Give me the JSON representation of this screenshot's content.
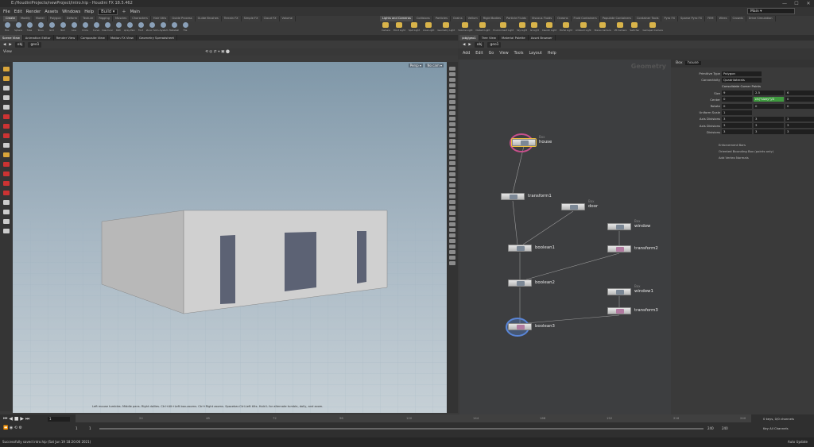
{
  "window": {
    "title": "E:/HoudiniProjects/newProject/intro.hip - Houdini FX 18.5.462",
    "controls": [
      "—",
      "☐",
      "✕"
    ]
  },
  "menu": {
    "items": [
      "File",
      "Edit",
      "Render",
      "Assets",
      "Windows",
      "Help"
    ],
    "desktop": "Build",
    "desktop_right": "Main"
  },
  "shelf_tabs_left": [
    "Create",
    "Modify",
    "Model",
    "Polygon",
    "Deform",
    "Texture",
    "Rigging",
    "Muscles",
    "Characters",
    "Hair Utils",
    "Guide Process",
    "Guide Brushes",
    "Terrain FX",
    "Simple FX",
    "Cloud FX",
    "Volume"
  ],
  "shelf_tabs_right": [
    "Lights and Cameras",
    "Collisions",
    "Particles",
    "Grains",
    "Vellum",
    "Rigid Bodies",
    "Particle Fluids",
    "Viscous Fluids",
    "Oceans",
    "Fluid Containers",
    "Populate Containers",
    "Container Tools",
    "Pyro FX",
    "Sparse Pyro FX",
    "FEM",
    "Wires",
    "Crowds",
    "Drive Simulation"
  ],
  "shelf_tools_left": [
    "Box",
    "Sphere",
    "Tube",
    "Torus",
    "Grid",
    "Null",
    "Line",
    "Circle",
    "Curve",
    "Draw Curve",
    "Path",
    "Spray Paint",
    "Font",
    "Platonic Solids",
    "L-System",
    "Metaball",
    "File"
  ],
  "shelf_tools_right": [
    "Camera",
    "Point Light",
    "Spot Light",
    "Area Light",
    "Geometry Light",
    "Volume Light",
    "Distant Light",
    "Environment Light",
    "Sky Light",
    "GI Light",
    "Caustic Light",
    "Portal Light",
    "Ambient Light",
    "Stereo Camera",
    "VR Camera",
    "Switcher",
    "Gamepad Camera"
  ],
  "left_pane_tabs": [
    "Scene View",
    "Animation Editor",
    "Render View",
    "Composite View",
    "Motion FX View",
    "Geometry Spreadsheet"
  ],
  "right_pane_tabs": [
    "/obj/geo1",
    "Tree View",
    "Material Palette",
    "Asset Browser"
  ],
  "left_path": [
    "obj",
    "geo1"
  ],
  "right_path": [
    "obj",
    "geo1"
  ],
  "viewport": {
    "label": "View",
    "persp": "Persp",
    "cam": "No cam",
    "hint": "Left mouse tumbles. Middle pans. Right dollies. Ctrl+Alt+Left box-zooms. Ctrl+Right zooms. Spacebar-Ctrl-Left tilts. Hold L for alternate tumble, dolly, and zoom."
  },
  "network": {
    "menu": [
      "Add",
      "Edit",
      "Go",
      "View",
      "Tools",
      "Layout",
      "Help"
    ],
    "context_label": "Geometry",
    "nodes": [
      {
        "name": "house",
        "type": "Box"
      },
      {
        "name": "transform1",
        "type": ""
      },
      {
        "name": "door",
        "type": "Box"
      },
      {
        "name": "window",
        "type": "Box"
      },
      {
        "name": "boolean1",
        "type": ""
      },
      {
        "name": "transform2",
        "type": ""
      },
      {
        "name": "boolean2",
        "type": ""
      },
      {
        "name": "window1",
        "type": "Box"
      },
      {
        "name": "transform3",
        "type": ""
      },
      {
        "name": "boolean3",
        "type": ""
      }
    ]
  },
  "params": {
    "node_type": "Box",
    "node_name": "house",
    "rows": [
      {
        "label": "Primitive Type",
        "value": "Polygon"
      },
      {
        "label": "Connectivity",
        "value": "Quadrilaterals"
      },
      {
        "label": "",
        "value": "Consolidate Corner Points"
      },
      {
        "label": "Size",
        "v1": "9",
        "v2": "2.5",
        "v3": "6"
      },
      {
        "label": "Center",
        "v1": "0",
        "v2": "ch(\"sizey\")/2",
        "v3": "0"
      },
      {
        "label": "Rotate",
        "v1": "0",
        "v2": "0",
        "v3": "0"
      },
      {
        "label": "Uniform Scale",
        "v1": "1"
      },
      {
        "label": "Axis Divisions",
        "v1": "3",
        "v2": "3",
        "v3": "3"
      },
      {
        "label": "Axis Divisions",
        "v1": "3",
        "v2": "3",
        "v3": "3"
      },
      {
        "label": "Divisions",
        "v1": "3",
        "v2": "3",
        "v3": "3"
      }
    ],
    "checks": [
      "Enforcement Bars",
      "Oriented Bounding Box (points only)",
      "Add Vertex Normals"
    ]
  },
  "timeline": {
    "frame": "1",
    "ticks": [
      "24",
      "48",
      "72",
      "96",
      "120",
      "144",
      "168",
      "192",
      "216",
      "240"
    ],
    "start": "1",
    "start2": "1",
    "end": "240",
    "end2": "240",
    "keys_label": "0 keys, 0/0 channels",
    "channels": "Key All Channels",
    "auto_update": "Auto Update"
  },
  "status": "Successfully saved intro.hip (Sat Jun 19 18:20:06 2021)"
}
